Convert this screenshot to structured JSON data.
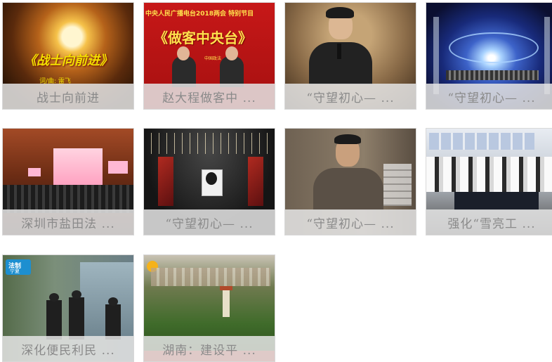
{
  "tiles": [
    {
      "caption": "战士向前进",
      "thumb_text": "《战士向前进》",
      "thumb_sub": "词/曲: 雷飞"
    },
    {
      "caption": "赵大程做客中 ...",
      "thumb_title": "中央人民广播电台2018两会 特别节目",
      "thumb_banner": "《做客中央台》",
      "thumb_logo": "中国政法"
    },
    {
      "caption": "“守望初心— ..."
    },
    {
      "caption": "“守望初心— ..."
    },
    {
      "caption": "深圳市盐田法 ..."
    },
    {
      "caption": "“守望初心— ..."
    },
    {
      "caption": "“守望初心— ..."
    },
    {
      "caption": "强化“雪亮工 ..."
    },
    {
      "caption": "深化便民利民 ...",
      "thumb_logo": "法制",
      "thumb_logo2": "宁夏"
    },
    {
      "caption": "湖南：建设平 ..."
    }
  ],
  "colors": {
    "caption_text": "#8a8a8a",
    "caption_bg": "#e4e4e4"
  }
}
